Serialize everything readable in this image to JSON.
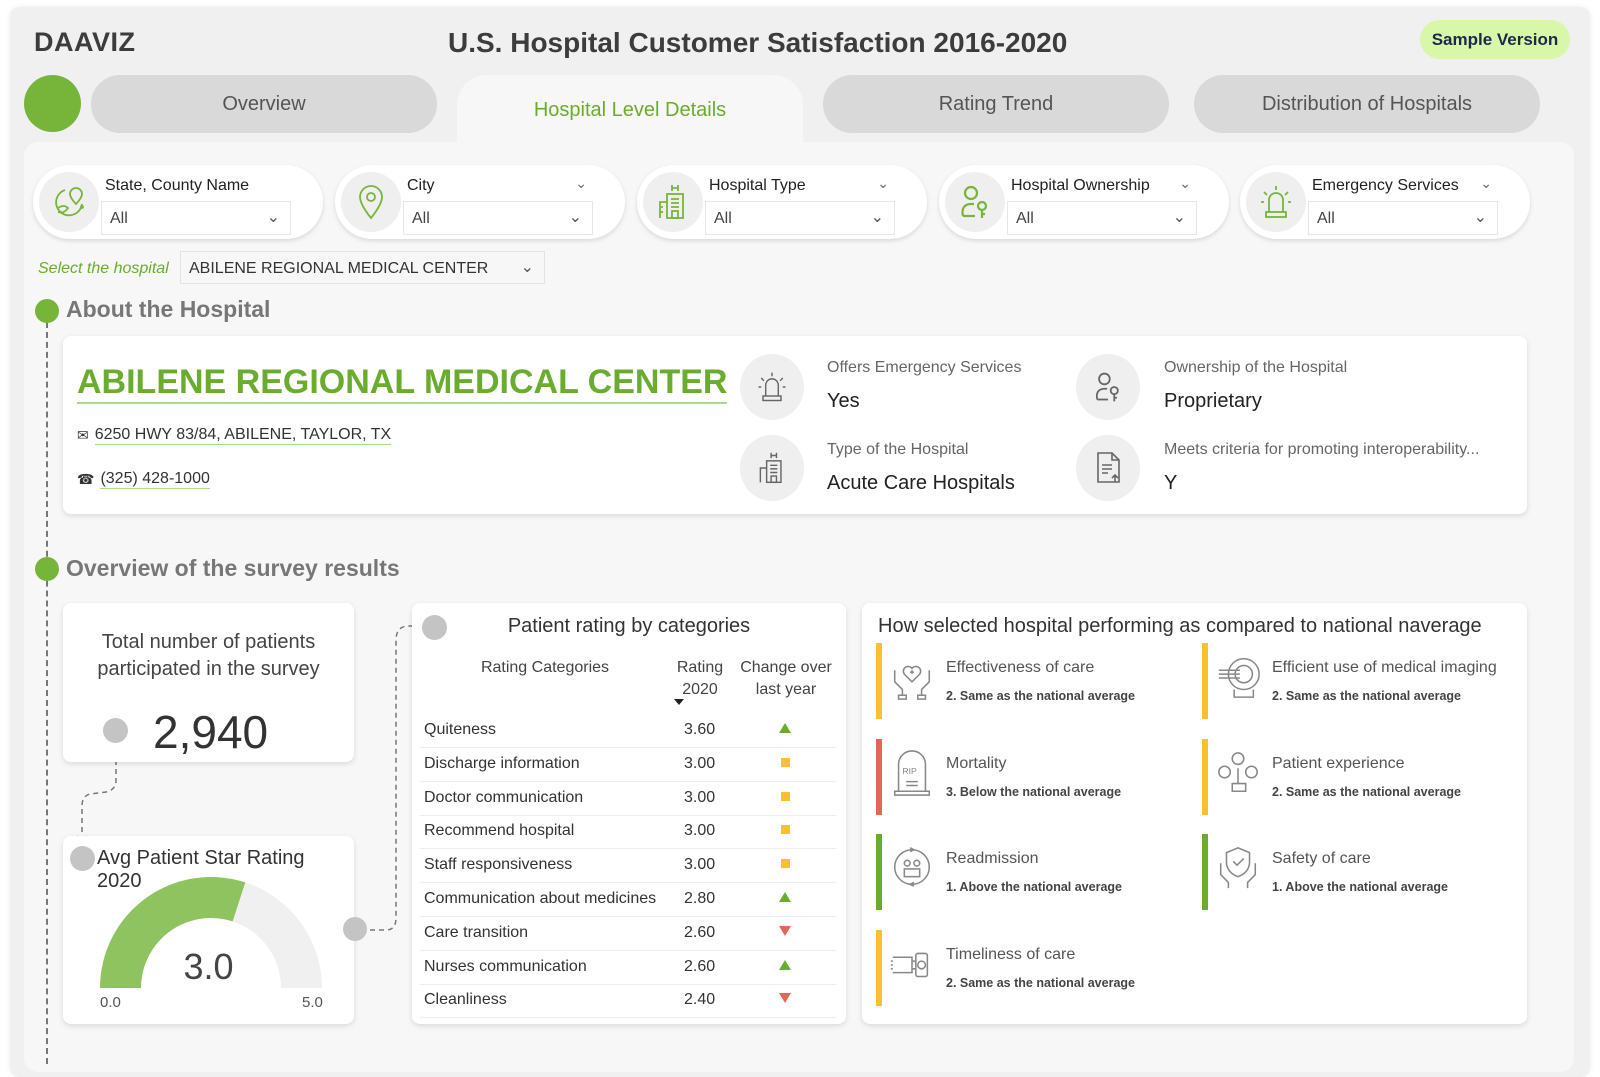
{
  "header": {
    "brand": "DAAVIZ",
    "title": "U.S. Hospital Customer Satisfaction 2016-2020",
    "badge": "Sample Version"
  },
  "tabs": [
    {
      "label": "Overview",
      "active": false
    },
    {
      "label": "Hospital Level Details",
      "active": true
    },
    {
      "label": "Rating Trend",
      "active": false
    },
    {
      "label": "Distribution of Hospitals",
      "active": false
    }
  ],
  "filters": [
    {
      "label": "State, County Name",
      "value": "All",
      "icon": "globe-pin-icon"
    },
    {
      "label": "City",
      "value": "All",
      "icon": "map-pin-icon"
    },
    {
      "label": "Hospital Type",
      "value": "All",
      "icon": "hospital-building-icon"
    },
    {
      "label": "Hospital Ownership",
      "value": "All",
      "icon": "owner-key-icon"
    },
    {
      "label": "Emergency Services",
      "value": "All",
      "icon": "siren-icon"
    }
  ],
  "hospital_selector": {
    "label": "Select the hospital",
    "value": "ABILENE REGIONAL MEDICAL CENTER"
  },
  "about": {
    "section_title": "About the Hospital",
    "name": "ABILENE REGIONAL MEDICAL CENTER",
    "address": "6250 HWY 83/84, ABILENE, TAYLOR, TX",
    "phone": "(325) 428-1000",
    "info": [
      {
        "label": "Offers Emergency Services",
        "value": "Yes",
        "icon": "siren-icon"
      },
      {
        "label": "Ownership of the Hospital",
        "value": "Proprietary",
        "icon": "owner-key-icon"
      },
      {
        "label": "Type of the Hospital",
        "value": "Acute Care Hospitals",
        "icon": "hospital-building-icon"
      },
      {
        "label": "Meets criteria for promoting interoperability...",
        "value": "Y",
        "icon": "document-upload-icon"
      }
    ]
  },
  "survey": {
    "section_title": "Overview of the survey results",
    "kpi_caption_line1": "Total number of patients",
    "kpi_caption_line2": "participated in the survey",
    "kpi_value": "2,940",
    "gauge": {
      "title": "Avg Patient Star Rating 2020",
      "value": 3.0,
      "value_label": "3.0",
      "min": 0,
      "max": 5,
      "min_label": "0.0",
      "max_label": "5.0",
      "fill_color": "#8fc35f",
      "track_color": "#f0f0f0"
    },
    "table": {
      "title": "Patient rating by categories",
      "col1": "Rating Categories",
      "col2_line1": "Rating",
      "col2_line2": "2020",
      "col3_line1": "Change over",
      "col3_line2": "last year",
      "rows": [
        {
          "category": "Quiteness",
          "rating": "3.60",
          "change": "up"
        },
        {
          "category": "Discharge information",
          "rating": "3.00",
          "change": "same"
        },
        {
          "category": "Doctor communication",
          "rating": "3.00",
          "change": "same"
        },
        {
          "category": "Recommend hospital",
          "rating": "3.00",
          "change": "same"
        },
        {
          "category": "Staff responsiveness",
          "rating": "3.00",
          "change": "same"
        },
        {
          "category": "Communication about medicines",
          "rating": "2.80",
          "change": "up"
        },
        {
          "category": "Care transition",
          "rating": "2.60",
          "change": "down"
        },
        {
          "category": "Nurses communication",
          "rating": "2.60",
          "change": "up"
        },
        {
          "category": "Cleanliness",
          "rating": "2.40",
          "change": "down"
        }
      ]
    },
    "comparison": {
      "title": "How selected hospital performing as compared to national naverage",
      "items": [
        {
          "name": "Effectiveness of care",
          "status": "2. Same as the national average",
          "level": "same",
          "icon": "heart-hands-icon"
        },
        {
          "name": "Efficient use of medical imaging",
          "status": "2. Same as the national average",
          "level": "same",
          "icon": "mri-scanner-icon"
        },
        {
          "name": "Mortality",
          "status": "3. Below the national average",
          "level": "below",
          "icon": "tombstone-icon"
        },
        {
          "name": "Patient experience",
          "status": "2. Same as the national average",
          "level": "same",
          "icon": "feedback-faces-icon"
        },
        {
          "name": "Readmission",
          "status": "1. Above the national average",
          "level": "above",
          "icon": "readmission-cycle-icon"
        },
        {
          "name": "Safety of care",
          "status": "1. Above the national average",
          "level": "above",
          "icon": "shield-hands-icon"
        },
        {
          "name": "Timeliness of care",
          "status": "2. Same as the national average",
          "level": "same",
          "icon": "wristwatch-icon"
        }
      ]
    }
  },
  "colors": {
    "accent": "#77b53a",
    "up": "#6aad2e",
    "same": "#fcbf30",
    "down": "#e0675a",
    "above": "#6aad2e",
    "below": "#e0675a"
  }
}
